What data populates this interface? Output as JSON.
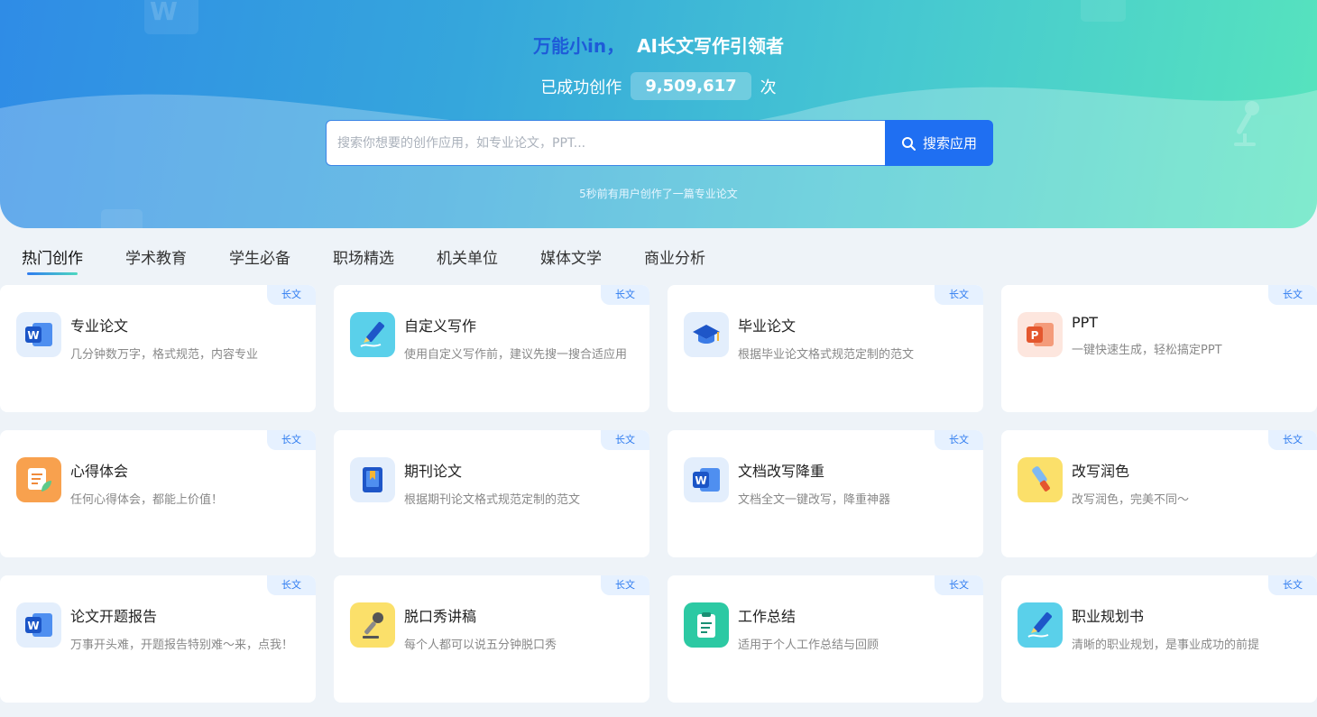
{
  "banner": {
    "brand": "万能小in，",
    "tagline": "AI长文写作引领者",
    "count_prefix": "已成功创作",
    "count_value": "9,509,617",
    "count_suffix": "次",
    "search_placeholder": "搜索你想要的创作应用，如专业论文，PPT...",
    "search_button": "搜索应用",
    "notice": "5秒前有用户创作了一篇专业论文"
  },
  "tabs": [
    {
      "label": "热门创作",
      "active": true
    },
    {
      "label": "学术教育",
      "active": false
    },
    {
      "label": "学生必备",
      "active": false
    },
    {
      "label": "职场精选",
      "active": false
    },
    {
      "label": "机关单位",
      "active": false
    },
    {
      "label": "媒体文学",
      "active": false
    },
    {
      "label": "商业分析",
      "active": false
    }
  ],
  "cards": [
    {
      "title": "专业论文",
      "desc": "几分钟数万字，格式规范，内容专业",
      "badge": "长文",
      "icon": "word-icon"
    },
    {
      "title": "自定义写作",
      "desc": "使用自定义写作前，建议先搜一搜合适应用",
      "badge": "长文",
      "icon": "pen-icon"
    },
    {
      "title": "毕业论文",
      "desc": "根据毕业论文格式规范定制的范文",
      "badge": "长文",
      "icon": "graduation-cap-icon"
    },
    {
      "title": "PPT",
      "desc": "一键快速生成，轻松搞定PPT",
      "badge": "长文",
      "icon": "ppt-icon"
    },
    {
      "title": "心得体会",
      "desc": "任何心得体会，都能上价值！",
      "badge": "长文",
      "icon": "notebook-leaf-icon"
    },
    {
      "title": "期刊论文",
      "desc": "根据期刊论文格式规范定制的范文",
      "badge": "长文",
      "icon": "journal-book-icon"
    },
    {
      "title": "文档改写降重",
      "desc": "文档全文一键改写，降重神器",
      "badge": "长文",
      "icon": "word-icon"
    },
    {
      "title": "改写润色",
      "desc": "改写润色，完美不同～",
      "badge": "长文",
      "icon": "brush-icon"
    },
    {
      "title": "论文开题报告",
      "desc": "万事开头难，开题报告特别难～来，点我！",
      "badge": "长文",
      "icon": "word-icon"
    },
    {
      "title": "脱口秀讲稿",
      "desc": "每个人都可以说五分钟脱口秀",
      "badge": "长文",
      "icon": "microphone-icon"
    },
    {
      "title": "工作总结",
      "desc": "适用于个人工作总结与回顾",
      "badge": "长文",
      "icon": "clipboard-icon"
    },
    {
      "title": "职业规划书",
      "desc": "清晰的职业规划，是事业成功的前提",
      "badge": "长文",
      "icon": "pen-icon"
    }
  ],
  "colors": {
    "accent": "#1f6ff2",
    "brand": "#1e5bd8",
    "badge_text": "#2f7cf0",
    "badge_bg": "#e6f1ff"
  }
}
